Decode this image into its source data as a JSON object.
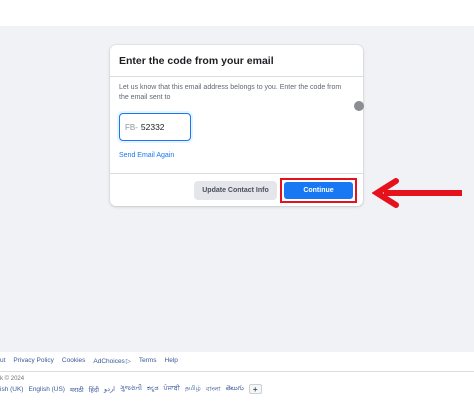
{
  "dialog": {
    "title": "Enter the code from your email",
    "description": "Let us know that this email address belongs to you. Enter the code from the email sent to",
    "code_prefix": "FB-",
    "code_value": "52332",
    "send_again_label": "Send Email Again",
    "update_contact_label": "Update Contact Info",
    "continue_label": "Continue"
  },
  "footer": {
    "links": [
      "ut",
      "Privacy Policy",
      "Cookies",
      "AdChoices",
      "Terms",
      "Help"
    ],
    "copyright": "k © 2024",
    "languages": [
      "ish (UK)",
      "English (US)",
      "मराठी",
      "हिंदी",
      "اردو",
      "ગુજરાતી",
      "ಕನ್ನಡ",
      "ਪੰਜਾਬੀ",
      "தமிழ்",
      "বাংলা",
      "తెలుగు"
    ],
    "add_language_label": "+"
  },
  "colors": {
    "accent": "#1877f2",
    "highlight": "#e5111c",
    "background": "#f0f2f5"
  }
}
